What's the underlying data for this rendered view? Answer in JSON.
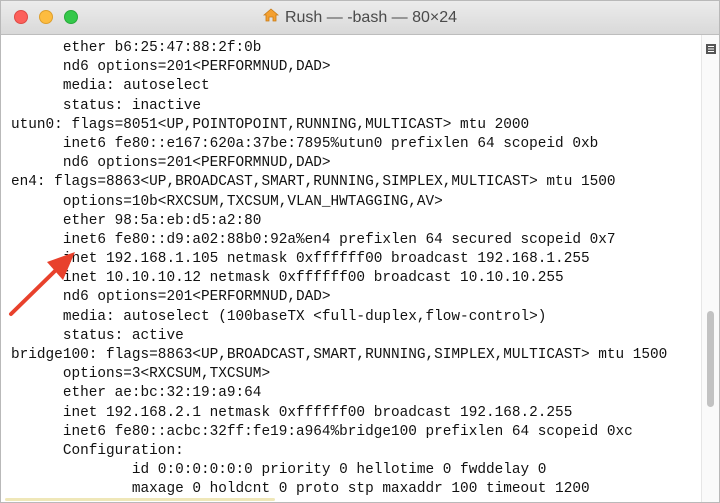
{
  "window": {
    "title": "Rush — -bash — 80×24"
  },
  "terminal": {
    "lines": [
      "      ether b6:25:47:88:2f:0b",
      "      nd6 options=201<PERFORMNUD,DAD>",
      "      media: autoselect",
      "      status: inactive",
      "utun0: flags=8051<UP,POINTOPOINT,RUNNING,MULTICAST> mtu 2000",
      "      inet6 fe80::e167:620a:37be:7895%utun0 prefixlen 64 scopeid 0xb",
      "      nd6 options=201<PERFORMNUD,DAD>",
      "en4: flags=8863<UP,BROADCAST,SMART,RUNNING,SIMPLEX,MULTICAST> mtu 1500",
      "      options=10b<RXCSUM,TXCSUM,VLAN_HWTAGGING,AV>",
      "      ether 98:5a:eb:d5:a2:80",
      "      inet6 fe80::d9:a02:88b0:92a%en4 prefixlen 64 secured scopeid 0x7",
      "      inet 192.168.1.105 netmask 0xffffff00 broadcast 192.168.1.255",
      "      inet 10.10.10.12 netmask 0xffffff00 broadcast 10.10.10.255",
      "      nd6 options=201<PERFORMNUD,DAD>",
      "      media: autoselect (100baseTX <full-duplex,flow-control>)",
      "      status: active",
      "bridge100: flags=8863<UP,BROADCAST,SMART,RUNNING,SIMPLEX,MULTICAST> mtu 1500",
      "      options=3<RXCSUM,TXCSUM>",
      "      ether ae:bc:32:19:a9:64",
      "      inet 192.168.2.1 netmask 0xffffff00 broadcast 192.168.2.255",
      "      inet6 fe80::acbc:32ff:fe19:a964%bridge100 prefixlen 64 scopeid 0xc",
      "      Configuration:",
      "              id 0:0:0:0:0:0 priority 0 hellotime 0 fwddelay 0",
      "              maxage 0 holdcnt 0 proto stp maxaddr 100 timeout 1200"
    ]
  },
  "annotation": {
    "color": "#e8412c"
  }
}
